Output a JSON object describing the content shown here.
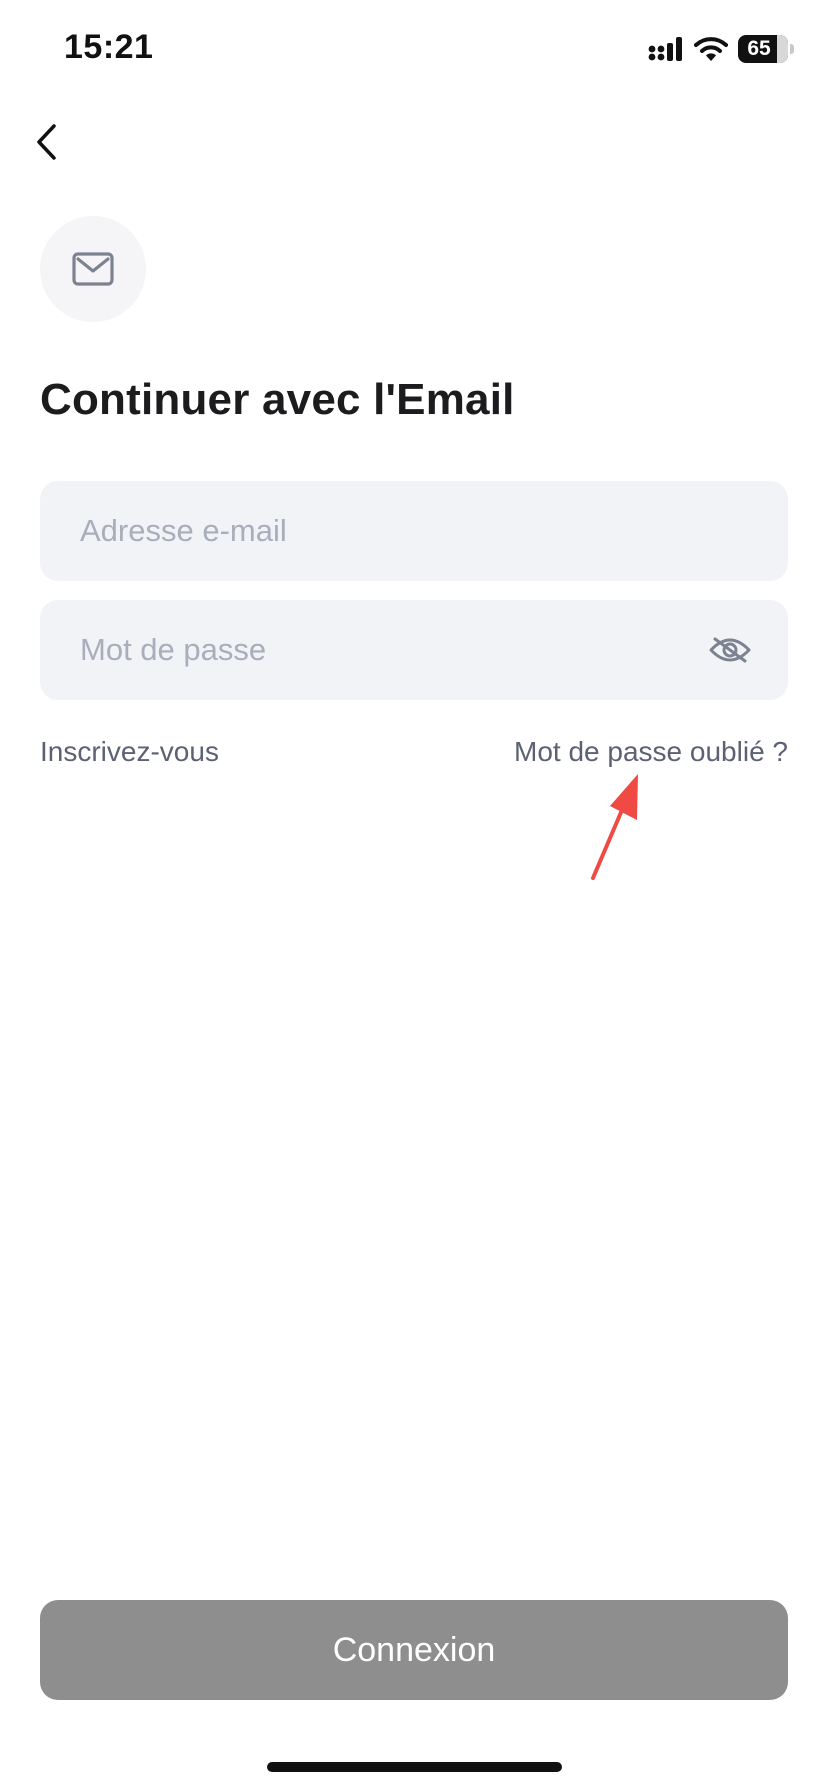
{
  "status_bar": {
    "time": "15:21",
    "battery_level": "65",
    "icons": [
      "signal-icon",
      "wifi-icon",
      "battery-icon"
    ]
  },
  "nav": {
    "back_icon": "chevron-left-icon"
  },
  "header": {
    "icon": "mail-icon",
    "title": "Continuer avec l'Email"
  },
  "form": {
    "email": {
      "value": "",
      "placeholder": "Adresse e-mail"
    },
    "password": {
      "value": "",
      "placeholder": "Mot de passe",
      "toggle_icon": "eye-off-icon"
    }
  },
  "links": {
    "signup": "Inscrivez-vous",
    "forgot_password": "Mot de passe oublié ?"
  },
  "annotation": {
    "icon": "red-arrow-icon",
    "color": "#f04a45"
  },
  "actions": {
    "login_label": "Connexion",
    "login_color": "#8e8e8e"
  }
}
